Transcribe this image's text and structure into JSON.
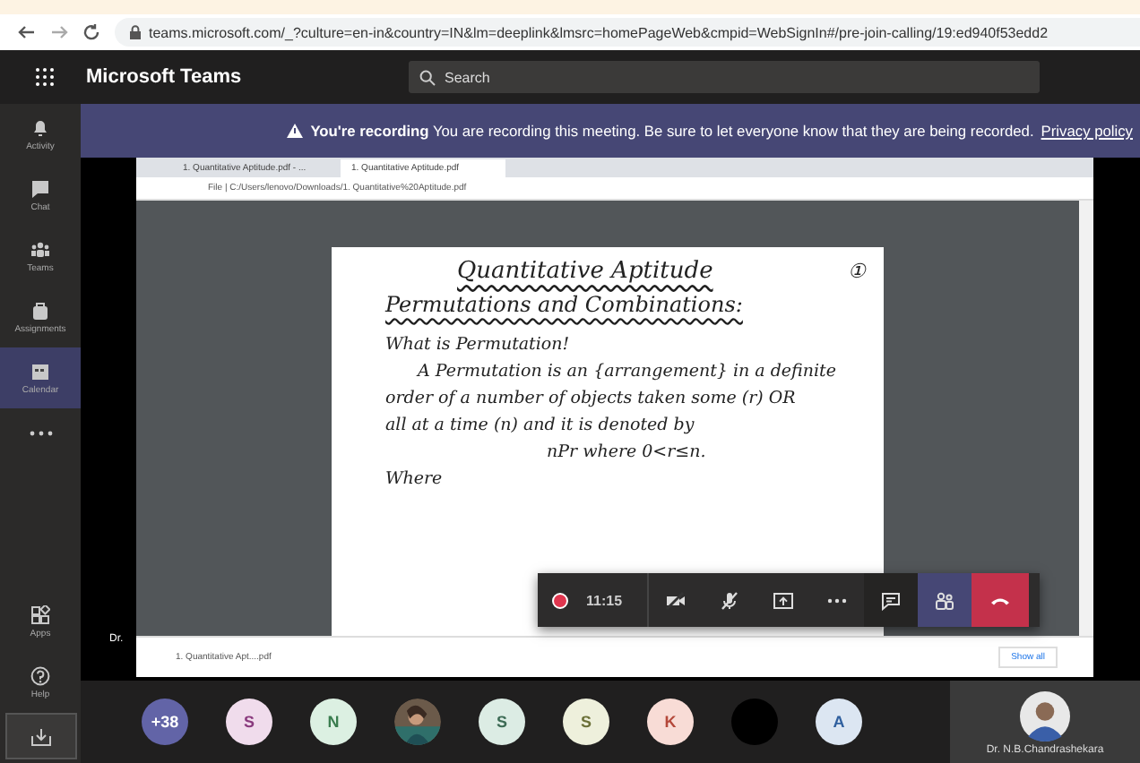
{
  "browser": {
    "url": "teams.microsoft.com/_?culture=en-in&country=IN&lm=deeplink&lmsrc=homePageWeb&cmpid=WebSignIn#/pre-join-calling/19:ed940f53edd2"
  },
  "app": {
    "title": "Microsoft Teams",
    "search_placeholder": "Search"
  },
  "banner": {
    "heading": "You're recording",
    "message": "You are recording this meeting. Be sure to let everyone know that they are being recorded.",
    "link": "Privacy policy"
  },
  "rail": [
    {
      "label": "Activity",
      "selected": false
    },
    {
      "label": "Chat",
      "selected": false
    },
    {
      "label": "Teams",
      "selected": false
    },
    {
      "label": "Assignments",
      "selected": false
    },
    {
      "label": "Calendar",
      "selected": true
    }
  ],
  "rail_bottom": [
    {
      "label": "Apps"
    },
    {
      "label": "Help"
    }
  ],
  "shared_screen": {
    "tabs": [
      {
        "label": "1. Quantitative Aptitude.pdf - ...",
        "selected": false
      },
      {
        "label": "1. Quantitative Aptitude.pdf",
        "selected": true
      }
    ],
    "address": "File | C:/Users/lenovo/Downloads/1. Quantitative%20Aptitude.pdf",
    "page": {
      "title": "Quantitative Aptitude",
      "page_number": "①",
      "lines": [
        {
          "kind": "heading",
          "text": "Permutations and Combinations:"
        },
        {
          "kind": "line",
          "text": "What is Permutation!"
        },
        {
          "kind": "indent",
          "text": "A Permutation is an {arrangement} in a definite"
        },
        {
          "kind": "line",
          "text": "order of a number of objects taken some (r) OR"
        },
        {
          "kind": "line",
          "text": "all at a time (n) and it is denoted by"
        },
        {
          "kind": "center",
          "text": "nPr where 0<r≤n."
        },
        {
          "kind": "line",
          "text": "Where"
        }
      ]
    },
    "download": {
      "file": "1. Quantitative Apt....pdf",
      "show_all": "Show all"
    }
  },
  "stage_name": "Dr.",
  "call": {
    "recording": true,
    "timer": "11:15",
    "buttons": [
      {
        "kind": "camera_off",
        "selected": false
      },
      {
        "kind": "mic_off",
        "selected": false
      },
      {
        "kind": "share",
        "selected": false
      },
      {
        "kind": "more",
        "selected": false
      },
      {
        "kind": "chat",
        "selected": false
      },
      {
        "kind": "people",
        "selected": true
      },
      {
        "kind": "hangup",
        "selected": false
      }
    ]
  },
  "participants": [
    {
      "kind": "count",
      "label": "+38",
      "color": "#6264a7"
    },
    {
      "kind": "initial",
      "label": "S",
      "color": "#f0dcec"
    },
    {
      "kind": "initial",
      "label": "N",
      "color": "#dcf0e2"
    },
    {
      "kind": "picture"
    },
    {
      "kind": "initial",
      "label": "S",
      "color": "#dcece4"
    },
    {
      "kind": "initial",
      "label": "S",
      "color": "#eef0dc"
    },
    {
      "kind": "initial",
      "label": "K",
      "color": "#f8dcd6"
    },
    {
      "kind": "blank",
      "color": "#000000"
    },
    {
      "kind": "initial",
      "label": "A",
      "color": "#dce6f2"
    }
  ],
  "presenter": {
    "name": "Dr. N.B.Chandrashekara"
  }
}
